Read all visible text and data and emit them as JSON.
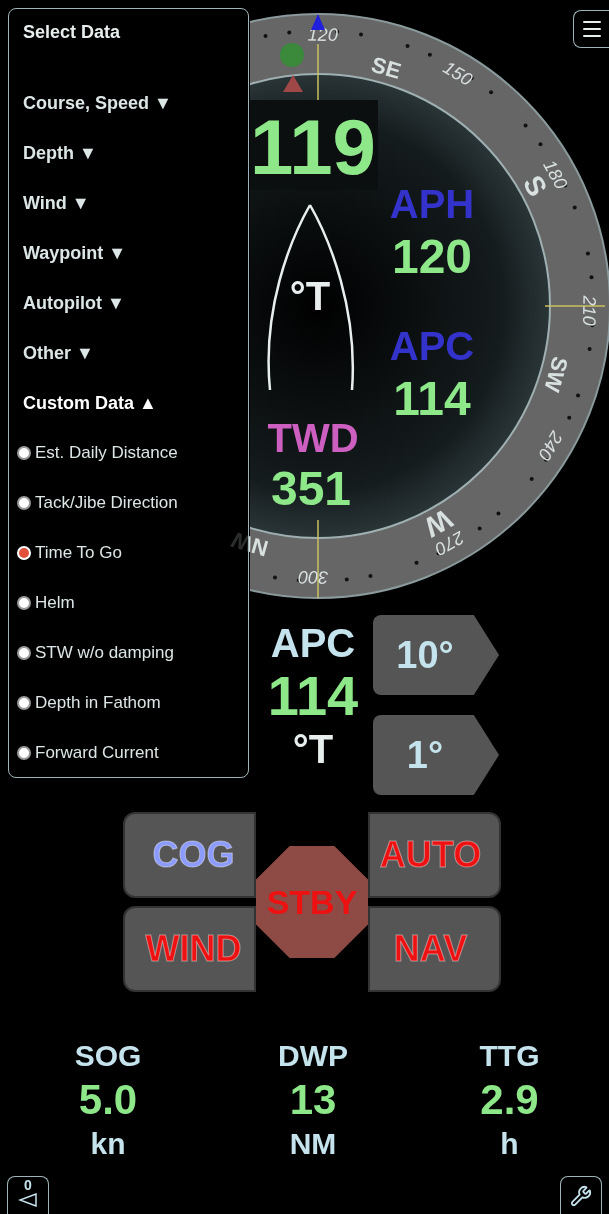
{
  "compass": {
    "heading": "119",
    "heading_unit": "°T",
    "degree_labels": [
      "120",
      "150",
      "180",
      "210",
      "240",
      "270",
      "300"
    ],
    "cardinal_labels": [
      "SE",
      "S",
      "SW",
      "W",
      "NW"
    ],
    "readouts": [
      {
        "kind": "side",
        "label": "APH",
        "value": "120",
        "color": "#3333cc"
      },
      {
        "kind": "side",
        "label": "APC",
        "value": "114",
        "color": "#3333cc"
      },
      {
        "kind": "center",
        "label": "TWD",
        "value": "351",
        "color": "#cc5fc0"
      }
    ]
  },
  "autopilot": {
    "label": "APC",
    "value": "114",
    "unit": "°T",
    "steps": [
      "10°",
      "1°"
    ]
  },
  "modes": [
    {
      "label": "COG",
      "color": "#8b9bff"
    },
    {
      "label": "AUTO",
      "color": "#ee1111"
    },
    {
      "label": "WIND",
      "color": "#ee1111"
    },
    {
      "label": "NAV",
      "color": "#ee1111"
    }
  ],
  "standby": {
    "label": "STBY"
  },
  "stats": [
    {
      "label": "SOG",
      "value": "5.0",
      "unit": "kn"
    },
    {
      "label": "DWP",
      "value": "13",
      "unit": "NM"
    },
    {
      "label": "TTG",
      "value": "2.9",
      "unit": "h"
    }
  ],
  "bottom_left_button": {
    "label": "0"
  },
  "select_panel": {
    "title": "Select Data",
    "sections": [
      {
        "label": "Course, Speed ▼",
        "expanded": false
      },
      {
        "label": "Depth ▼",
        "expanded": false
      },
      {
        "label": "Wind ▼",
        "expanded": false
      },
      {
        "label": "Waypoint ▼",
        "expanded": false
      },
      {
        "label": "Autopilot ▼",
        "expanded": false
      },
      {
        "label": "Other ▼",
        "expanded": false
      },
      {
        "label": "Custom Data ▲",
        "expanded": true,
        "children": [
          {
            "label": "Est. Daily Distance",
            "selected": false
          },
          {
            "label": "Tack/Jibe Direction",
            "selected": false
          },
          {
            "label": "Time To Go",
            "selected": true
          },
          {
            "label": "Helm",
            "selected": false
          },
          {
            "label": "STW w/o damping",
            "selected": false
          },
          {
            "label": "Depth in Fathom",
            "selected": false
          },
          {
            "label": "Forward Current",
            "selected": false
          }
        ]
      }
    ]
  }
}
